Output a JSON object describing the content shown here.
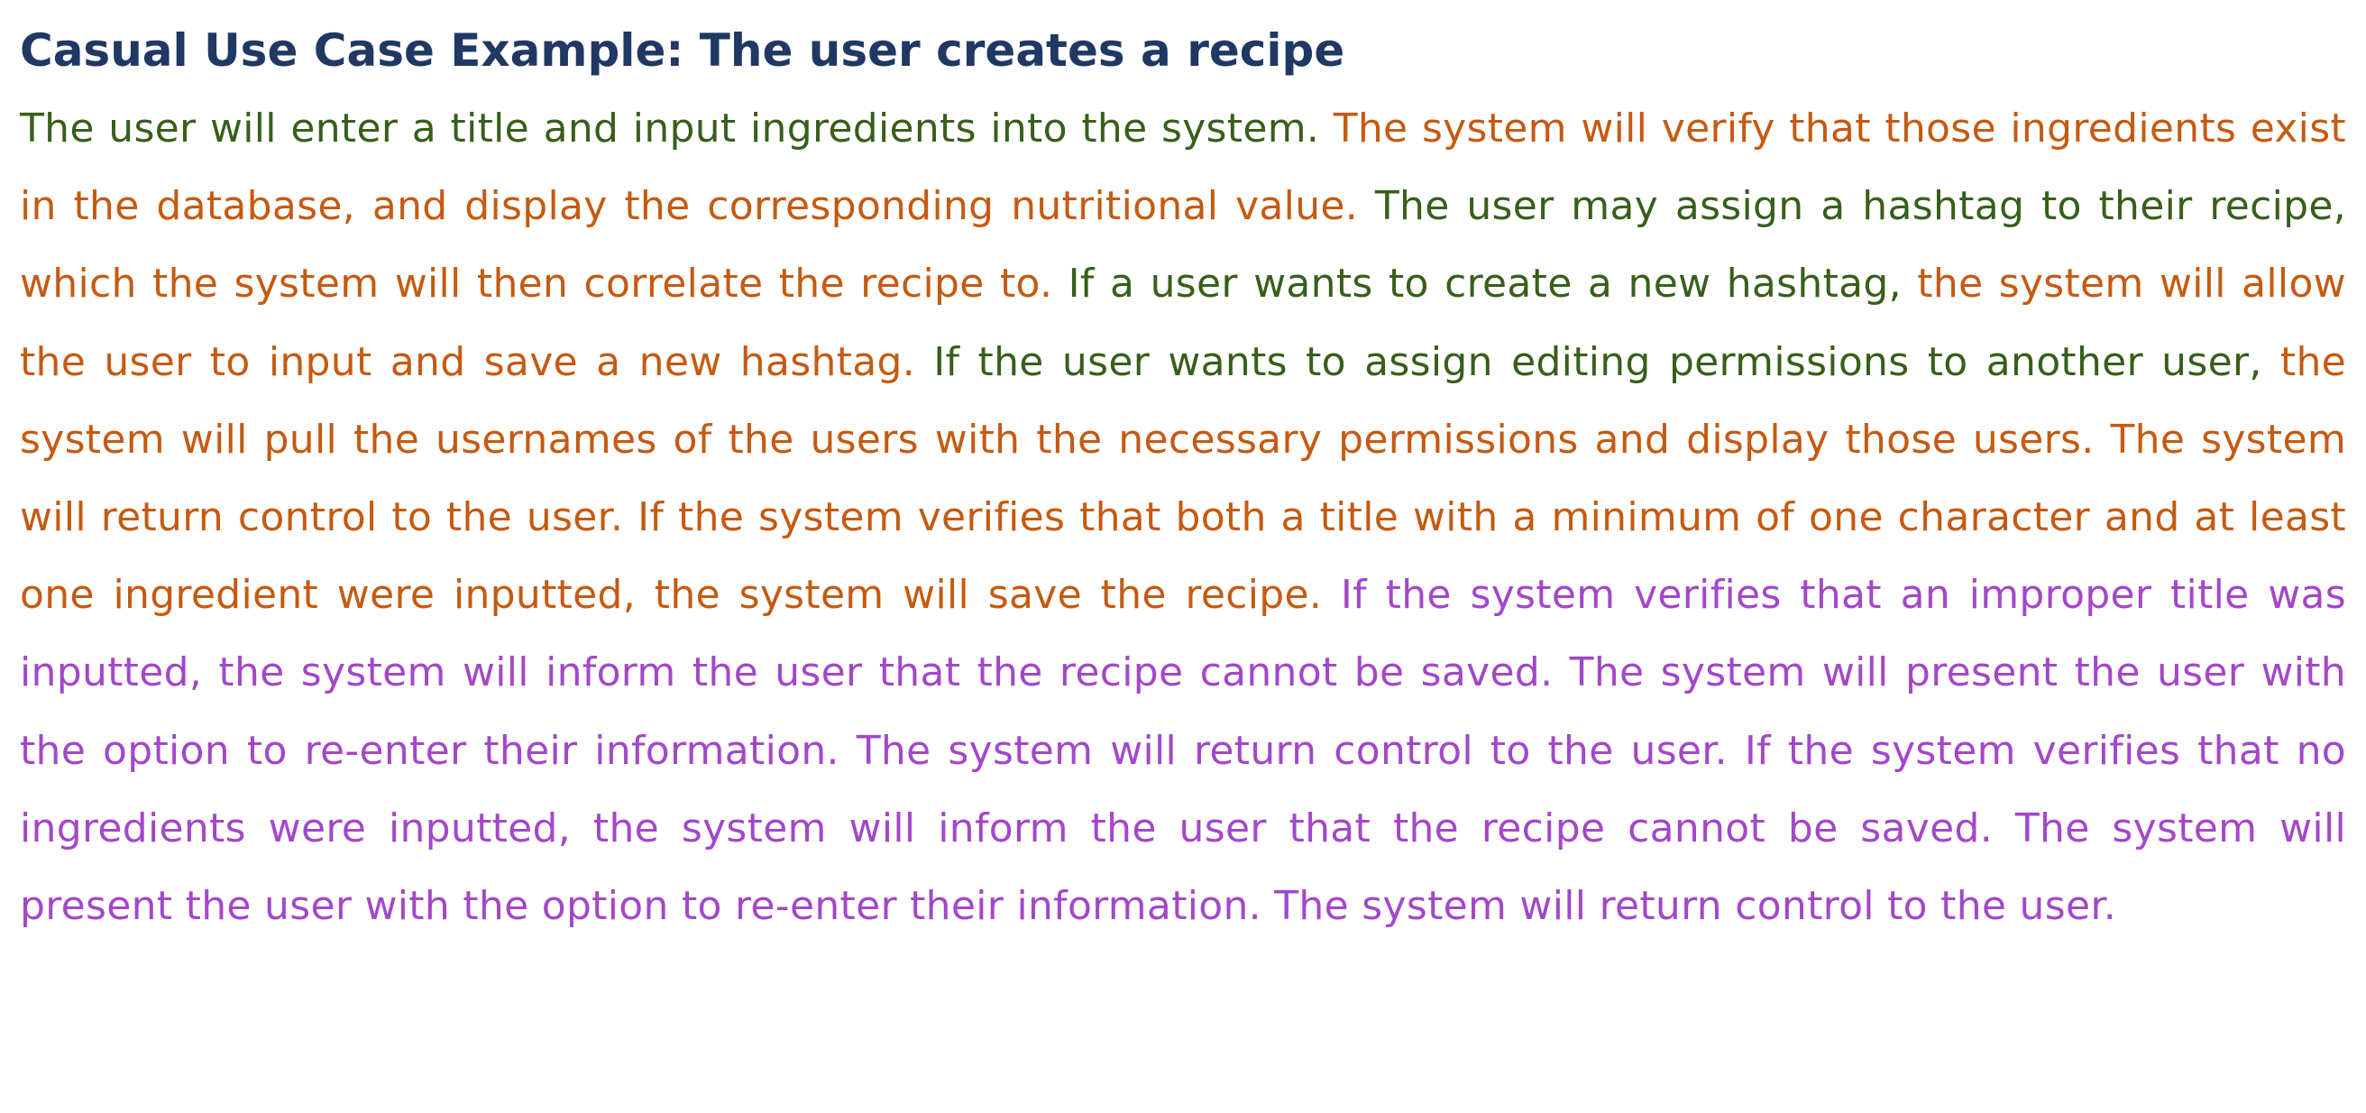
{
  "document": {
    "title": "Casual Use Case Example: The user creates a recipe",
    "colors": {
      "title": "#1f3864",
      "user_action": "#375f1a",
      "system_response": "#c55a11",
      "alternate_flow": "#a347c9"
    },
    "segments": [
      {
        "text": "The user will enter a title and input ingredients into the system. ",
        "role": "user_action"
      },
      {
        "text": "The system will verify that those ingredients exist in the database, and display the corresponding nutritional value. ",
        "role": "system_response"
      },
      {
        "text": "The user may assign a hashtag to their recipe, ",
        "role": "user_action"
      },
      {
        "text": "which the system will then correlate the recipe to. ",
        "role": "system_response"
      },
      {
        "text": "If a user wants to create a new hashtag, ",
        "role": "user_action"
      },
      {
        "text": "the system will allow the user to input and save a new hashtag. ",
        "role": "system_response"
      },
      {
        "text": "If the user wants to assign editing permissions to another user, ",
        "role": "user_action"
      },
      {
        "text": "the system will pull the usernames of the users with the necessary permissions and display those users. The system will return control to the user. If the system verifies that both a title with a minimum of one character and at least one ingredient were inputted, the system will save the recipe. ",
        "role": "system_response"
      },
      {
        "text": "If the system verifies that an improper title was inputted, the system will inform the user that the recipe cannot be saved. The system will present the user with the option to re-enter their information. The system will return control to the user. If the system verifies that no ingredients were inputted, the system will inform the user that the recipe cannot be saved.  The system will present the user with the option to re-enter their information. The system will return control to the user.",
        "role": "alternate_flow"
      }
    ]
  }
}
